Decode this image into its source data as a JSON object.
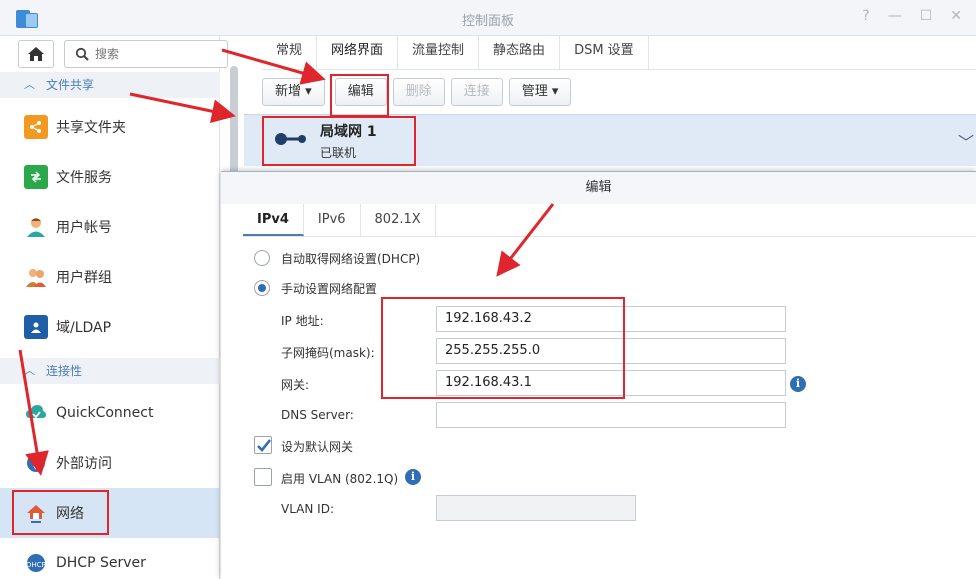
{
  "window": {
    "title": "控制面板",
    "controls": [
      "?",
      "—",
      "☐",
      "✕"
    ]
  },
  "sidebar": {
    "search_placeholder": "搜索",
    "sections": [
      {
        "label": "文件共享"
      },
      {
        "label": "连接性"
      }
    ],
    "items": [
      {
        "label": "共享文件夹",
        "icon": "shared-folder-icon",
        "color": "#f29a1f"
      },
      {
        "label": "文件服务",
        "icon": "file-services-icon",
        "color": "#2aa84a"
      },
      {
        "label": "用户帐号",
        "icon": "user-icon",
        "color": "#d9772e"
      },
      {
        "label": "用户群组",
        "icon": "group-icon",
        "color": "#d9772e"
      },
      {
        "label": "域/LDAP",
        "icon": "domain-ldap-icon",
        "color": "#1f5fa8"
      },
      {
        "label": "QuickConnect",
        "icon": "quickconnect-icon",
        "color": "#2aa7a0"
      },
      {
        "label": "外部访问",
        "icon": "external-access-icon",
        "color": "#2f6db5"
      },
      {
        "label": "网络",
        "icon": "network-icon",
        "color": "#e05a3a",
        "active": true
      },
      {
        "label": "DHCP Server",
        "icon": "dhcp-server-icon",
        "color": "#2f6db5"
      }
    ]
  },
  "tabs": [
    "常规",
    "网络界面",
    "流量控制",
    "静态路由",
    "DSM 设置"
  ],
  "active_tab": "网络界面",
  "toolbar": {
    "new": "新增",
    "edit": "编辑",
    "delete": "删除",
    "connect": "连接",
    "manage": "管理"
  },
  "interface": {
    "name": "局域网 1",
    "status": "已联机"
  },
  "dialog": {
    "title": "编辑",
    "tabs": [
      "IPv4",
      "IPv6",
      "802.1X"
    ],
    "dhcp_label": "自动取得网络设置(DHCP)",
    "manual_label": "手动设置网络配置",
    "ip_label": "IP 地址:",
    "ip_value": "192.168.43.2",
    "mask_label": "子网掩码(mask):",
    "mask_value": "255.255.255.0",
    "gateway_label": "网关:",
    "gateway_value": "192.168.43.1",
    "dns_label": "DNS Server:",
    "dns_value": "",
    "default_gateway_label": "设为默认网关",
    "vlan_label": "启用 VLAN (802.1Q)",
    "vlan_id_label": "VLAN ID:",
    "vlan_id_value": ""
  },
  "colors": {
    "accent": "#2f6db5",
    "annotation": "#e0262d",
    "selected_row": "#dfeaf6"
  }
}
